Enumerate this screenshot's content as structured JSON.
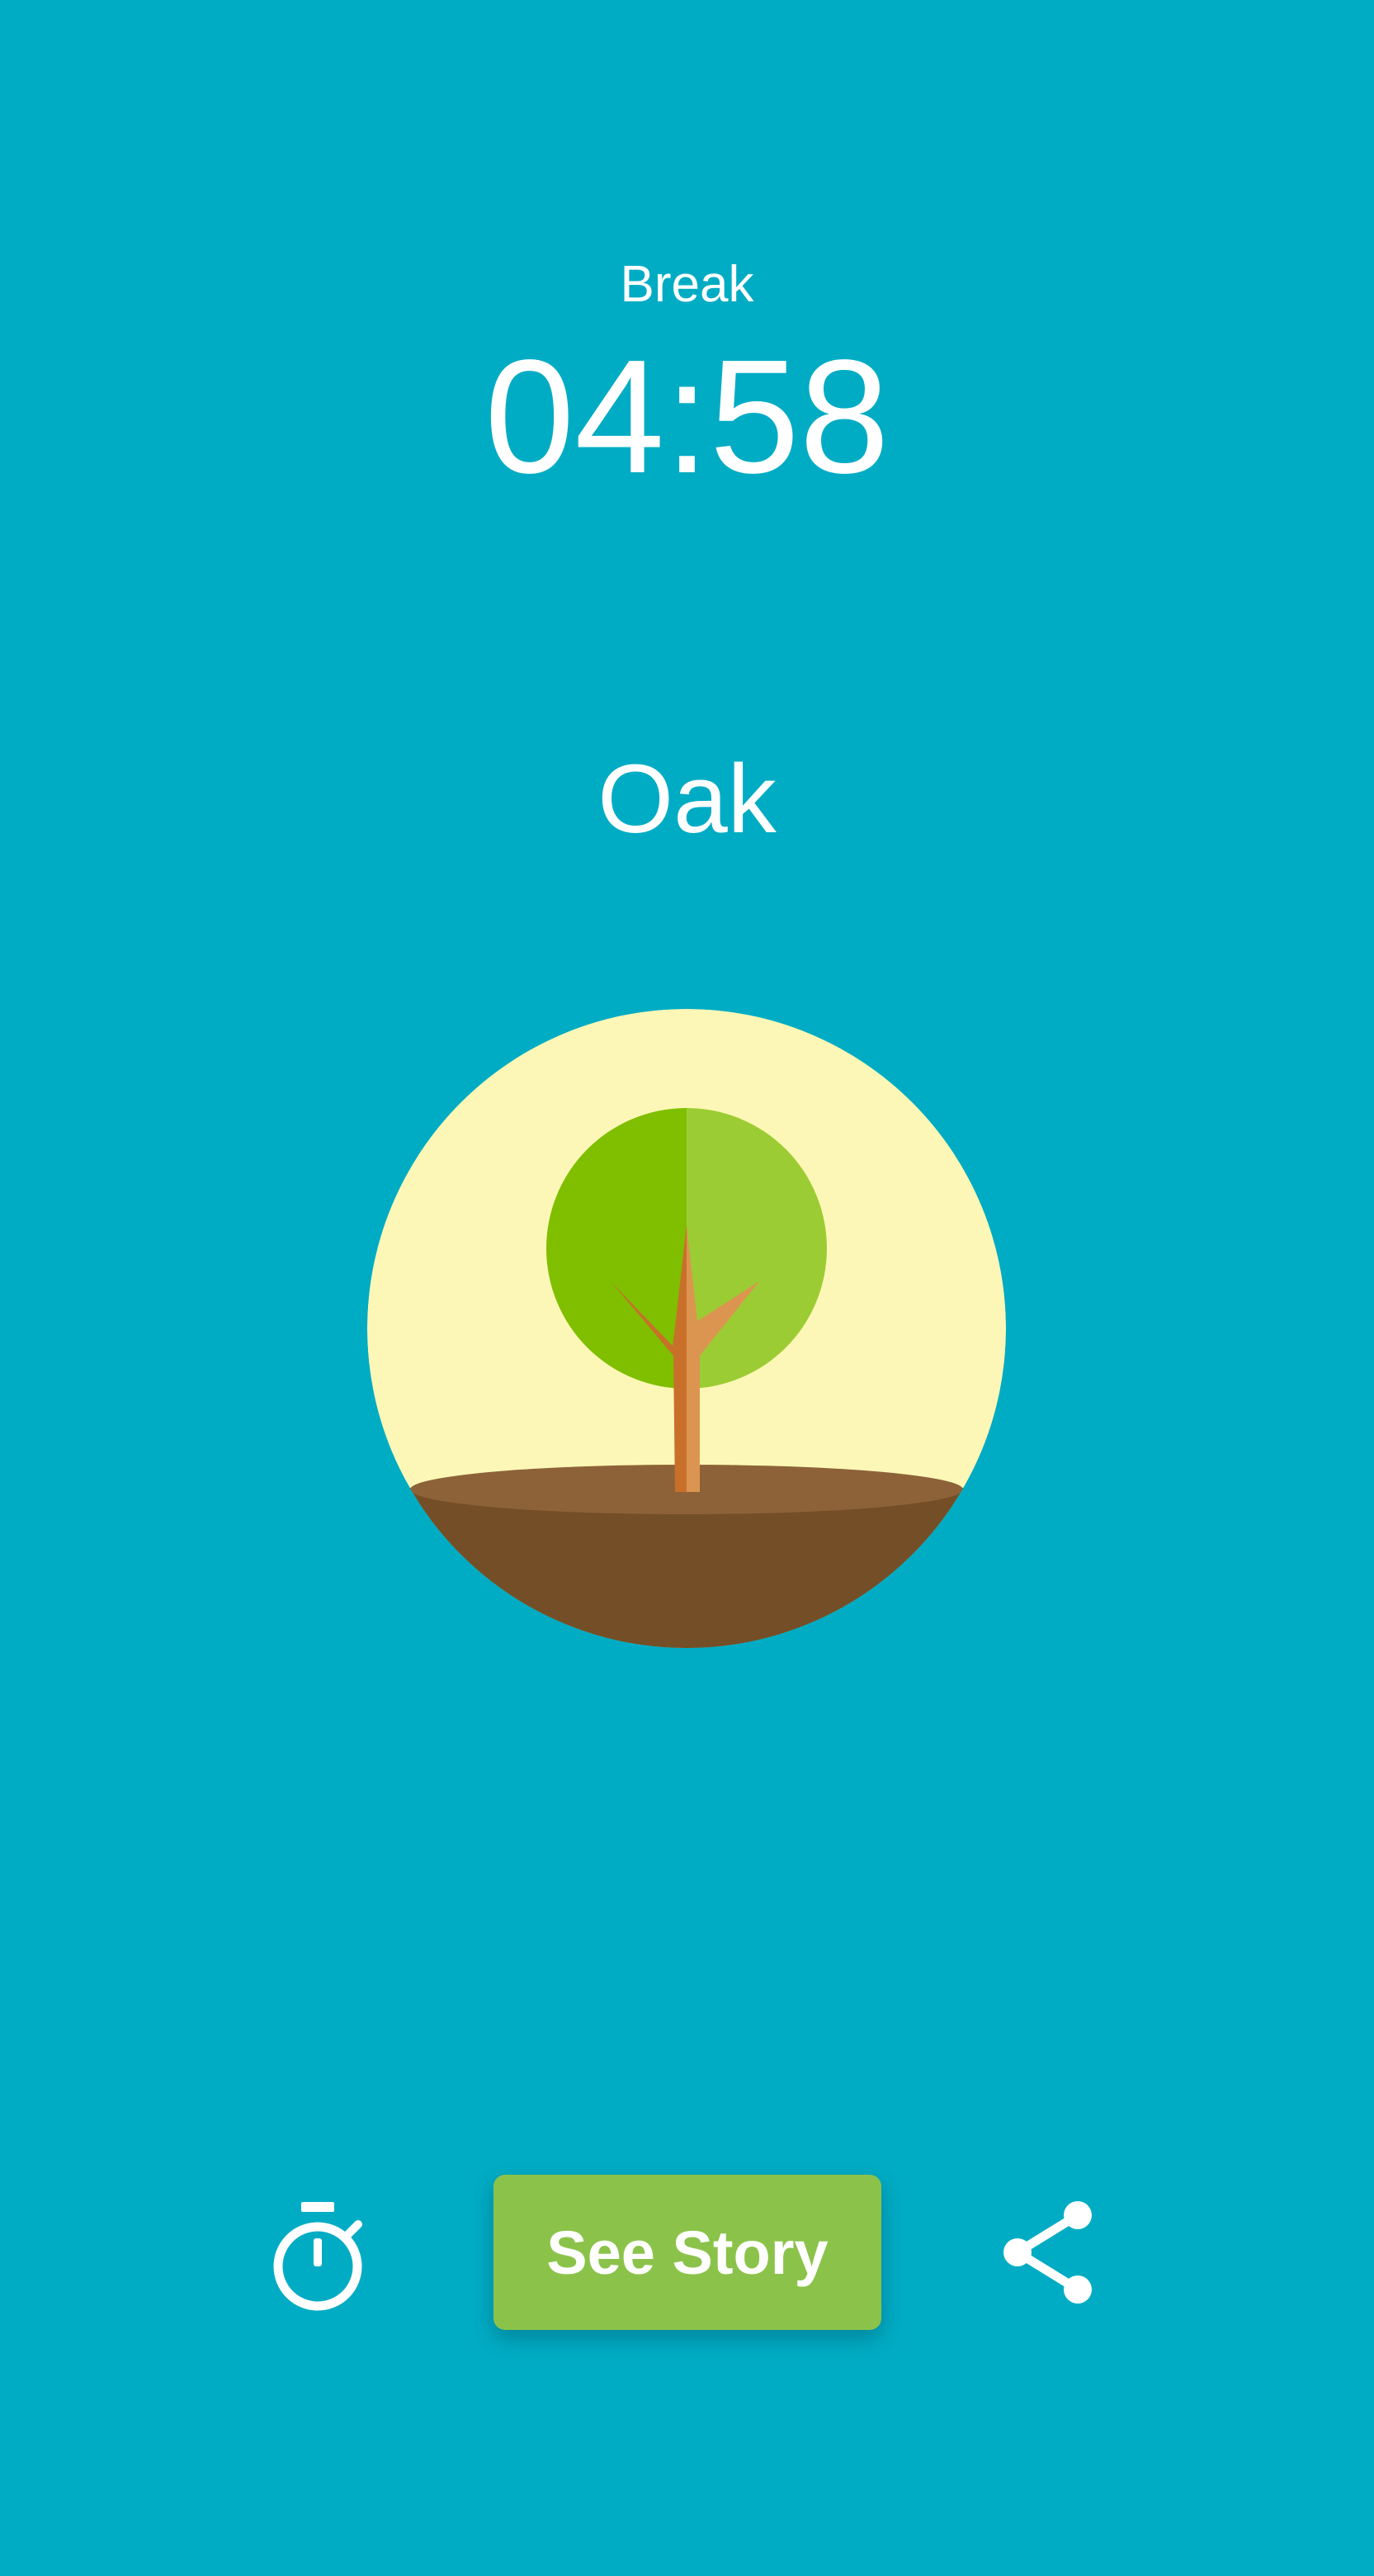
{
  "session": {
    "mode_label": "Break",
    "remaining_time": "04:58",
    "tree_name": "Oak"
  },
  "actions": {
    "see_story_label": "See Story",
    "timer_icon": "stopwatch-icon",
    "share_icon": "share-icon"
  },
  "colors": {
    "background": "#00acc4",
    "button": "#8bc34a",
    "sun": "#fcf7b6",
    "foliage_dark": "#7fbf00",
    "foliage_light": "#9ccc33",
    "trunk_dark": "#c8702a",
    "trunk_light": "#dc9550",
    "ground_top": "#8d6239",
    "ground": "#744e26"
  }
}
